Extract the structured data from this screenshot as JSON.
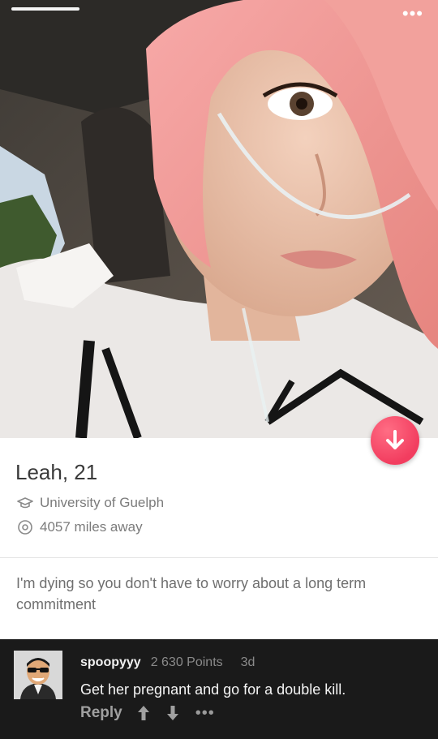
{
  "profile": {
    "name_age": "Leah, 21",
    "school": "University of Guelph",
    "distance": "4057 miles away",
    "bio": "I'm dying so you don't have to worry about a long term commitment"
  },
  "header": {
    "more_label": "•••"
  },
  "comment": {
    "username": "spoopyyy",
    "points": "2 630 Points",
    "age": "3d",
    "text": "Get her pregnant and go for a double kill.",
    "reply_label": "Reply",
    "more_label": "•••"
  },
  "colors": {
    "dislike_button": "#f23d5f",
    "card_background": "#ffffff",
    "comment_background": "#1a1a1a",
    "secondary_text": "#7b7b7b"
  },
  "icons": {
    "school": "graduation-cap-icon",
    "distance": "location-pin-icon",
    "dislike": "arrow-down-icon",
    "upvote": "arrow-up-icon",
    "downvote": "arrow-down-icon"
  }
}
